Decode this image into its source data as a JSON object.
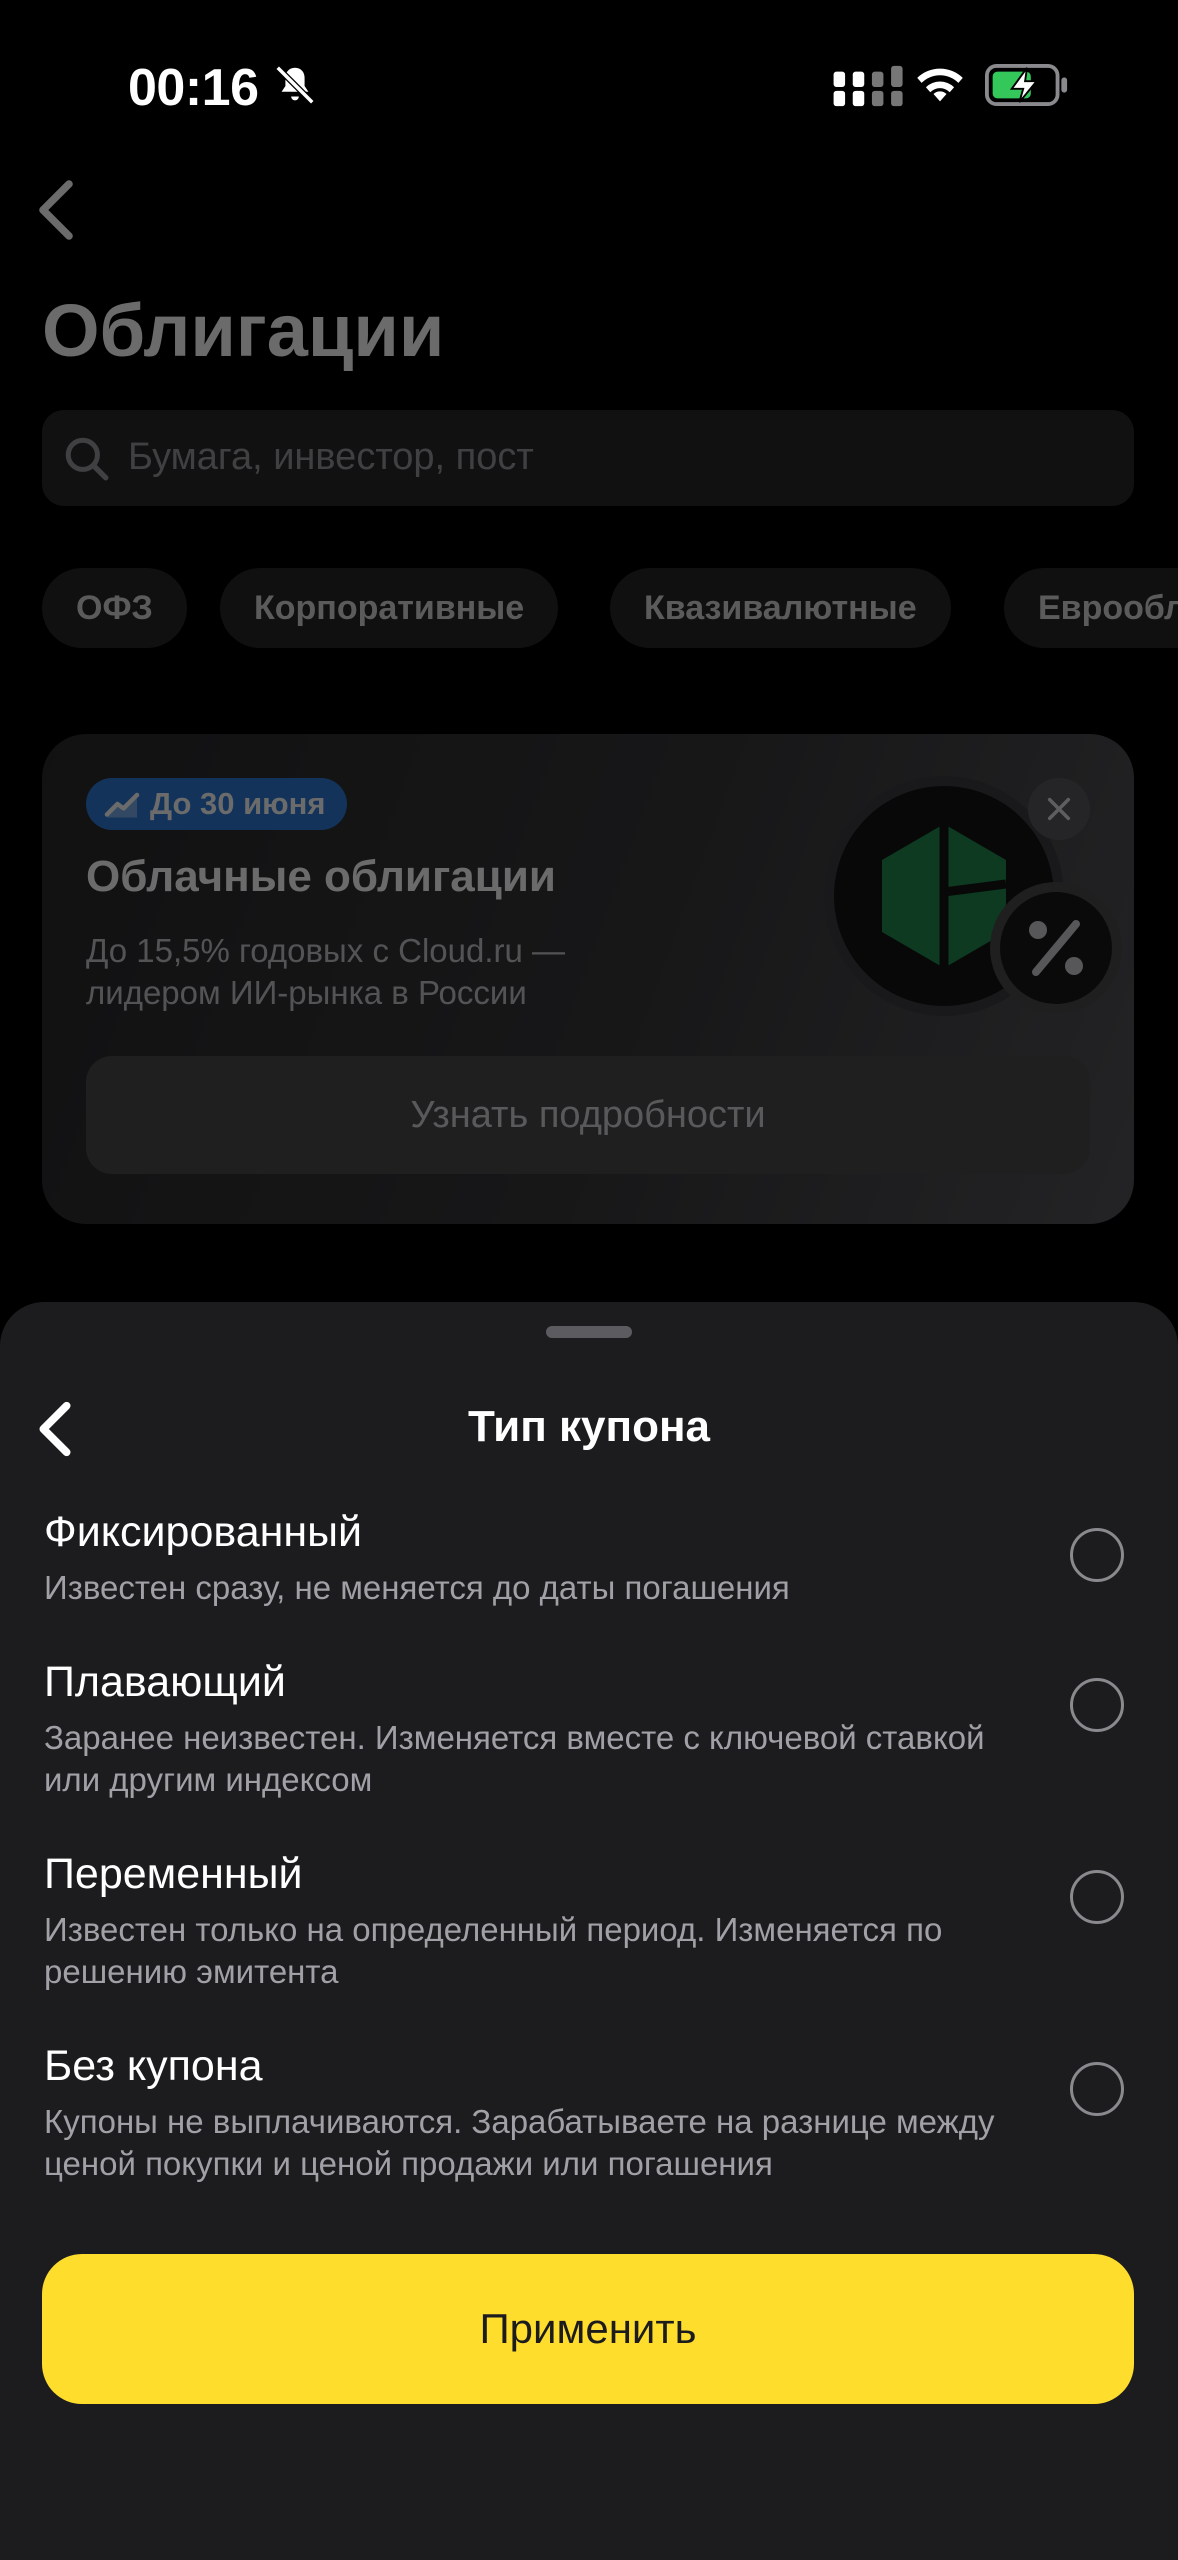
{
  "status_bar": {
    "time": "00:16"
  },
  "header": {
    "title": "Облигации"
  },
  "search": {
    "placeholder": "Бумага, инвестор, пост"
  },
  "filters": [
    "ОФЗ",
    "Корпоративные",
    "Квазивалютные",
    "Еврообл"
  ],
  "promo": {
    "badge": "До 30 июня",
    "title": "Облачные облигации",
    "subtitle": "До 15,5% годовых с Cloud.ru — лидером ИИ-рынка в России",
    "button": "Узнать подробности",
    "badge_color": "#2e7bd6",
    "icon_color": "#1f8a4c"
  },
  "sheet": {
    "title": "Тип купона",
    "options": [
      {
        "title": "Фиксированный",
        "desc": "Известен сразу, не меняется до даты погашения"
      },
      {
        "title": "Плавающий",
        "desc": "Заранее неизвестен. Изменяется вместе с ключевой ставкой или другим индексом"
      },
      {
        "title": "Переменный",
        "desc": "Известен только на определенный период. Изменяется по решению эмитента"
      },
      {
        "title": "Без купона",
        "desc": "Купоны не выплачиваются. Зарабатываете на разнице между ценой покупки и ценой продажи или погашения"
      }
    ],
    "apply_label": "Применить",
    "accent": "#ffdd2d"
  }
}
